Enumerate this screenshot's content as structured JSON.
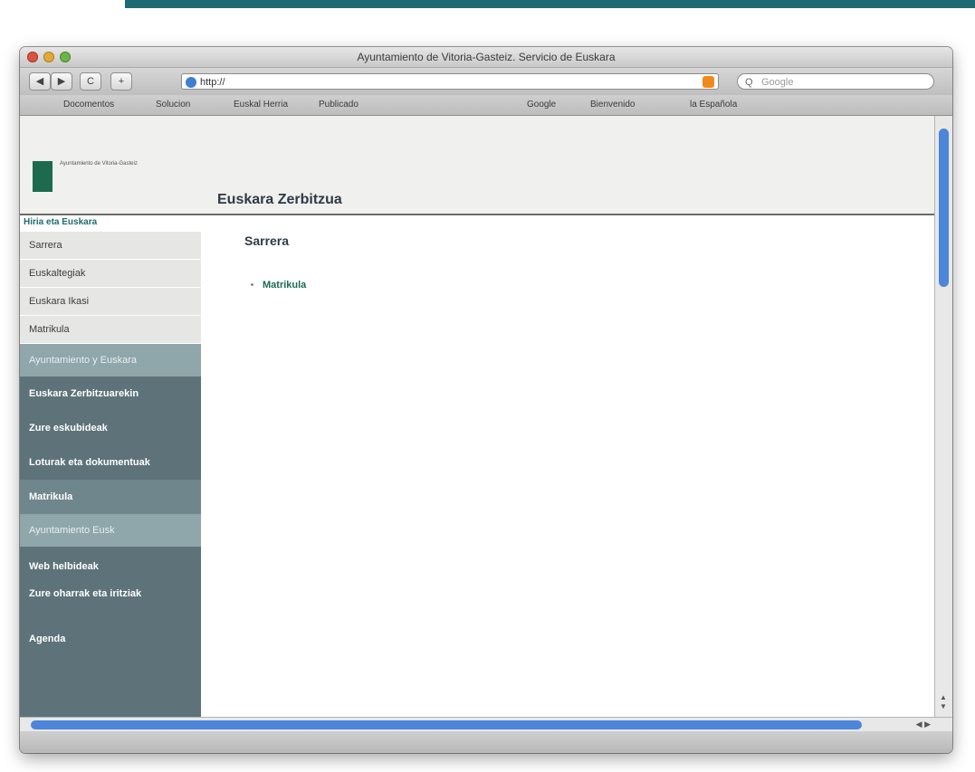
{
  "window": {
    "title": "Ayuntamiento de Vitoria-Gasteiz. Servicio de Euskara"
  },
  "toolbar": {
    "back_glyph": "◀",
    "forward_glyph": "▶",
    "reload_glyph": "C",
    "add_glyph": "+",
    "url_prefix": "http://",
    "search_placeholder": "Google",
    "search_glyph": "Q"
  },
  "bookmarks": {
    "items": [
      "Docomentos",
      "Solucion",
      "Euskal Herria",
      "Publicado",
      "Google",
      "Bienvenido",
      "la Española"
    ]
  },
  "page": {
    "site_title": "Euskara Zerbitzua",
    "logo_text": "Ayuntamiento de Vitoria-Gasteiz"
  },
  "sidebar": {
    "heading": "Hiria eta Euskara",
    "items": [
      {
        "label": "Sarrera"
      },
      {
        "label": "Euskaltegiak"
      },
      {
        "label": "Euskara Ikasi"
      },
      {
        "label": "Matrikula"
      }
    ],
    "section1": "Ayuntamiento y Euskara",
    "dark_items": [
      {
        "label": "Euskara Zerbitzuarekin"
      },
      {
        "label": "Zure eskubideak"
      },
      {
        "label": "Loturak eta dokumentuak"
      },
      {
        "label": "Matrikula"
      }
    ],
    "section2": "Ayuntamiento Eusk",
    "bottom_items": [
      {
        "label": "Web helbideak"
      },
      {
        "label": "Zure oharrak eta iritziak"
      },
      {
        "label": "Agenda"
      }
    ]
  },
  "content": {
    "title": "Sarrera",
    "list": [
      {
        "text_before": "",
        "link": "Matrikula"
      }
    ]
  },
  "colors": {
    "accent": "#1c6b4e",
    "sidebar_dark": "#5d7379",
    "sidebar_section": "#8fa6ab",
    "scroll_thumb": "#4b86d8",
    "top_band": "#1e6a73"
  }
}
